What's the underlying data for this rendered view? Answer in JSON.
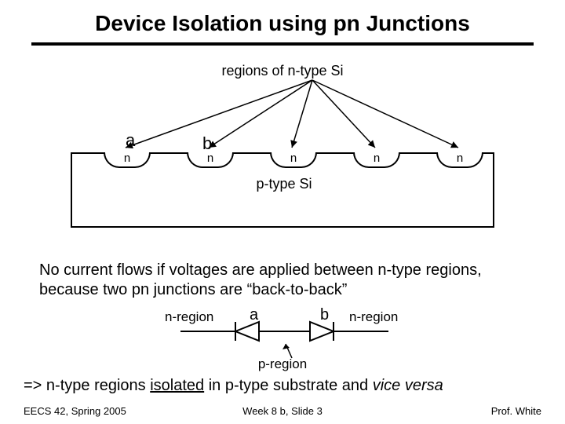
{
  "title": "Device Isolation using pn Junctions",
  "regions_label": "regions of n-type Si",
  "labels": {
    "a": "a",
    "b": "b"
  },
  "wells": {
    "n1": "n",
    "n2": "n",
    "n3": "n",
    "n4": "n",
    "n5": "n"
  },
  "ptype_si": "p-type Si",
  "body_text": "No current flows if voltages are applied between n-type regions, because two pn junctions are “back-to-back”",
  "diode": {
    "nregion_left": "n-region",
    "a": "a",
    "b": "b",
    "nregion_right": "n-region",
    "pregion": "p-region"
  },
  "conclusion": {
    "arrow": "=> ",
    "t1": "n-type regions ",
    "isolated": "isolated",
    "t2": " in p-type substrate and ",
    "vice_versa": "vice versa"
  },
  "footer": {
    "left": "EECS 42, Spring 2005",
    "center": "Week 8 b, Slide 3",
    "right": "Prof. White"
  }
}
